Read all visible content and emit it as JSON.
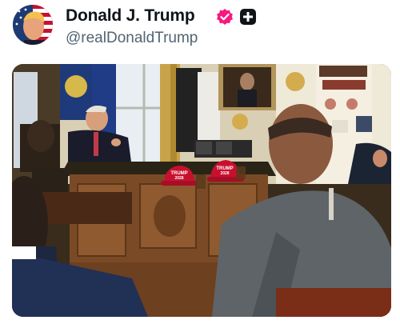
{
  "post": {
    "author": {
      "display_name": "Donald J. Trump",
      "handle": "@realDonaldTrump",
      "verified_icon": "verified-badge-icon",
      "affiliate_icon": "plus-badge-icon",
      "verified_color": "#f91880"
    },
    "media": {
      "hats": [
        {
          "line1": "TRUMP",
          "line2": "2028"
        },
        {
          "line1": "TRUMP",
          "line2": "2028"
        }
      ],
      "hat_color": "#c8102e"
    }
  }
}
